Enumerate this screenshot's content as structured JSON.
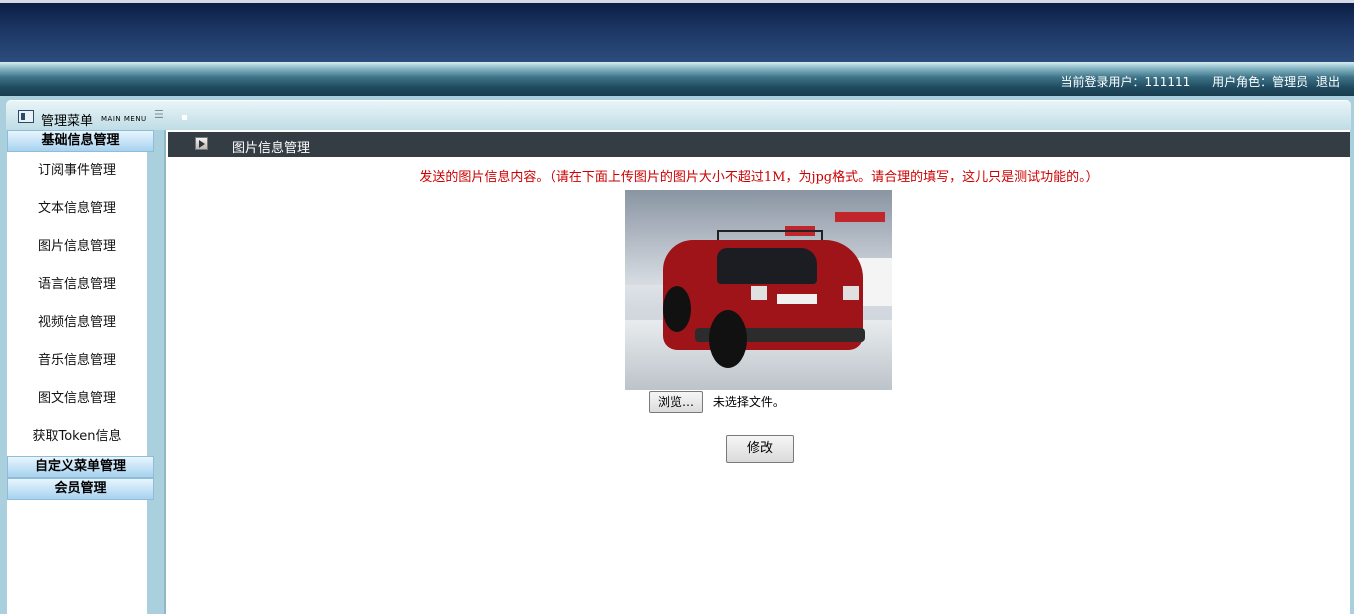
{
  "header": {
    "current_user_label": "当前登录用户：",
    "current_user": "111111",
    "role_label": "用户角色：",
    "role": "管理员",
    "logout": "退出"
  },
  "menu_panel": {
    "title": "管理菜单",
    "subtitle": "MAIN MENU"
  },
  "sidebar": {
    "groups": [
      {
        "label": "基础信息管理",
        "items": [
          "订阅事件管理",
          "文本信息管理",
          "图片信息管理",
          "语言信息管理",
          "视频信息管理",
          "音乐信息管理",
          "图文信息管理",
          "获取Token信息"
        ]
      },
      {
        "label": "自定义菜单管理"
      },
      {
        "label": "会员管理"
      }
    ]
  },
  "main": {
    "title": "图片信息管理",
    "notice": "发送的图片信息内容。（请在下面上传图片的图片大小不超过1M，为jpg格式。请合理的填写，这儿只是测试功能的。）",
    "browse_button": "浏览…",
    "file_status": "未选择文件。",
    "submit_button": "修改"
  },
  "colors": {
    "banner_dark": "#1c3664",
    "panel_bg": "#a9d0dc",
    "title_bar": "#343c44",
    "notice_red": "#cc0000",
    "group_header": "#c7e4f7"
  }
}
